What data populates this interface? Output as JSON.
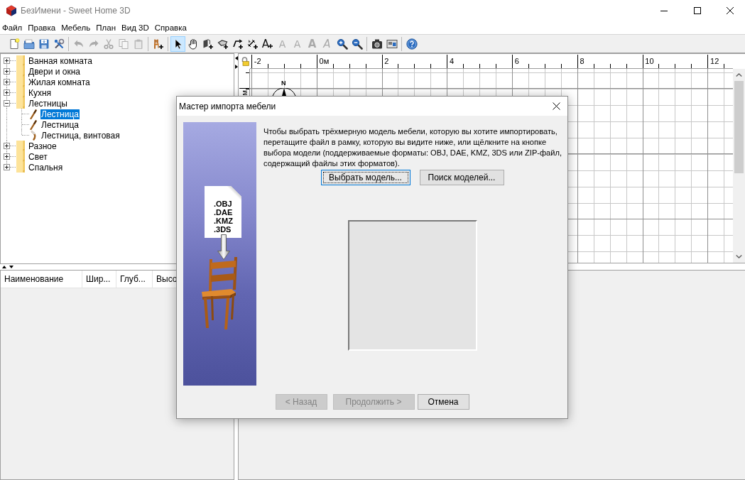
{
  "window": {
    "title": "БезИмени - Sweet Home 3D"
  },
  "menu": [
    "Файл",
    "Правка",
    "Мебель",
    "План",
    "Вид 3D",
    "Справка"
  ],
  "toolbar": [
    {
      "buttons": [
        {
          "disabled": false,
          "selected": false
        },
        {
          "disabled": false,
          "selected": false
        },
        {
          "disabled": false,
          "selected": false
        },
        {
          "disabled": false,
          "selected": false
        }
      ]
    },
    {
      "buttons": [
        {
          "disabled": true,
          "selected": false
        },
        {
          "disabled": true,
          "selected": false
        },
        {
          "disabled": true,
          "selected": false
        },
        {
          "disabled": true,
          "selected": false
        },
        {
          "disabled": true,
          "selected": false
        }
      ]
    },
    {
      "buttons": [
        {
          "disabled": false,
          "selected": false
        }
      ]
    },
    {
      "buttons": [
        {
          "disabled": false,
          "selected": true
        },
        {
          "disabled": false,
          "selected": false
        },
        {
          "disabled": false,
          "selected": false
        },
        {
          "disabled": false,
          "selected": false
        },
        {
          "disabled": false,
          "selected": false
        },
        {
          "disabled": false,
          "selected": false
        },
        {
          "glyph": "A",
          "disabled": false,
          "selected": false
        },
        {
          "glyph": "A",
          "disabled": true,
          "selected": false
        },
        {
          "glyph": "A",
          "disabled": true,
          "selected": false
        },
        {
          "glyph": "A",
          "disabled": true,
          "selected": false
        },
        {
          "glyph": "A",
          "disabled": true,
          "selected": false
        },
        {
          "disabled": false,
          "selected": false
        },
        {
          "disabled": false,
          "selected": false
        }
      ]
    },
    {
      "buttons": [
        {
          "disabled": false,
          "selected": false
        },
        {
          "disabled": false,
          "selected": false
        }
      ]
    },
    {
      "buttons": [
        {
          "disabled": false,
          "selected": false
        }
      ]
    }
  ],
  "catalog": [
    {
      "label": "Ванная комната",
      "expanded": false,
      "selected": false
    },
    {
      "label": "Двери и окна",
      "expanded": false,
      "selected": false
    },
    {
      "label": "Жилая комната",
      "expanded": false,
      "selected": false
    },
    {
      "label": "Кухня",
      "expanded": false,
      "selected": false
    },
    {
      "label": "Лестницы",
      "expanded": true,
      "selected": false,
      "children": [
        {
          "label": "Лестница",
          "kind": "straight",
          "selected": true
        },
        {
          "label": "Лестница",
          "kind": "straight",
          "selected": false
        },
        {
          "label": "Лестница, винтовая",
          "kind": "spiral",
          "selected": false
        }
      ]
    },
    {
      "label": "Разное",
      "expanded": false,
      "selected": false
    },
    {
      "label": "Свет",
      "expanded": false,
      "selected": false
    },
    {
      "label": "Спальня",
      "expanded": false,
      "selected": false
    }
  ],
  "furniture_table": {
    "columns": [
      "Наименование",
      "Шир...",
      "Глуб...",
      "Высо"
    ]
  },
  "plan": {
    "ruler_labels": [
      "-2",
      "0м",
      "2",
      "4",
      "6",
      "8",
      "10",
      "12"
    ],
    "vertical_ruler_labels": [
      "м"
    ],
    "compass": {
      "label": "N"
    }
  },
  "dialog": {
    "title": "Мастер импорта мебели",
    "illustration": {
      "formats": [
        ".OBJ",
        ".DAE",
        ".KMZ",
        ".3DS"
      ]
    },
    "instructions": "Чтобы выбрать трёхмерную модель мебели, которую вы хотите импортировать, перетащите файл в рамку, которую вы видите ниже, или щёлкните на кнопке выбора модели (поддерживаемые форматы: OBJ, DAE, KMZ, 3DS или ZIP-файл, содержащий файлы этих форматов).",
    "buttons": [
      {
        "label": "Выбрать модель...",
        "focused": true
      },
      {
        "label": "Поиск моделей...",
        "focused": false
      }
    ],
    "footer_buttons": [
      {
        "label": "< Назад",
        "disabled": true
      },
      {
        "label": "Продолжить >",
        "disabled": true
      },
      {
        "label": "Отмена",
        "disabled": false
      }
    ]
  }
}
